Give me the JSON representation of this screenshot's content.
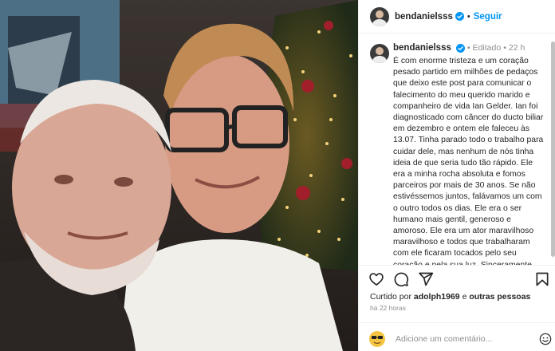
{
  "post": {
    "username": "bendanielsss",
    "follow_label": "Seguir",
    "edited_label": "Editado",
    "age": "22 h",
    "caption": "É com enorme tristeza e um coração pesado partido em milhões de pedaços que deixo este post para comunicar o falecimento do meu querido marido e companheiro de vida Ian Gelder. Ian foi diagnosticado com câncer do ducto biliar em dezembro e ontem ele faleceu às 13.07. Tinha parado todo o trabalho para cuidar dele, mas nenhum de nós tinha ideia de que seria tudo tão rápido. Ele era a minha rocha absoluta e fomos parceiros por mais de 30 anos. Se não estivéssemos juntos, falávamos um com o outro todos os dias. Ele era o ser humano mais gentil, generoso e amoroso. Ele era um ator maravilhoso maravilhoso e todos que trabalharam com ele ficaram tocados pelo seu coração e pela sua luz. Sinceramente não tenho a certeza de como seguir em frente sem ele.",
    "liked_prefix": "Curtido por",
    "liked_user": "adolph1969",
    "liked_suffix": "e",
    "liked_others": "outras pessoas",
    "timestamp": "há 22 horas",
    "comment_placeholder": "Adicione um comentário..."
  },
  "icons": {
    "verified": "verified-badge-icon",
    "like": "heart-icon",
    "comment": "comment-icon",
    "share": "share-icon",
    "save": "bookmark-icon",
    "emoji": "emoji-icon"
  },
  "colors": {
    "accent": "#0095f6",
    "muted": "#8e8e8e",
    "text": "#262626"
  }
}
